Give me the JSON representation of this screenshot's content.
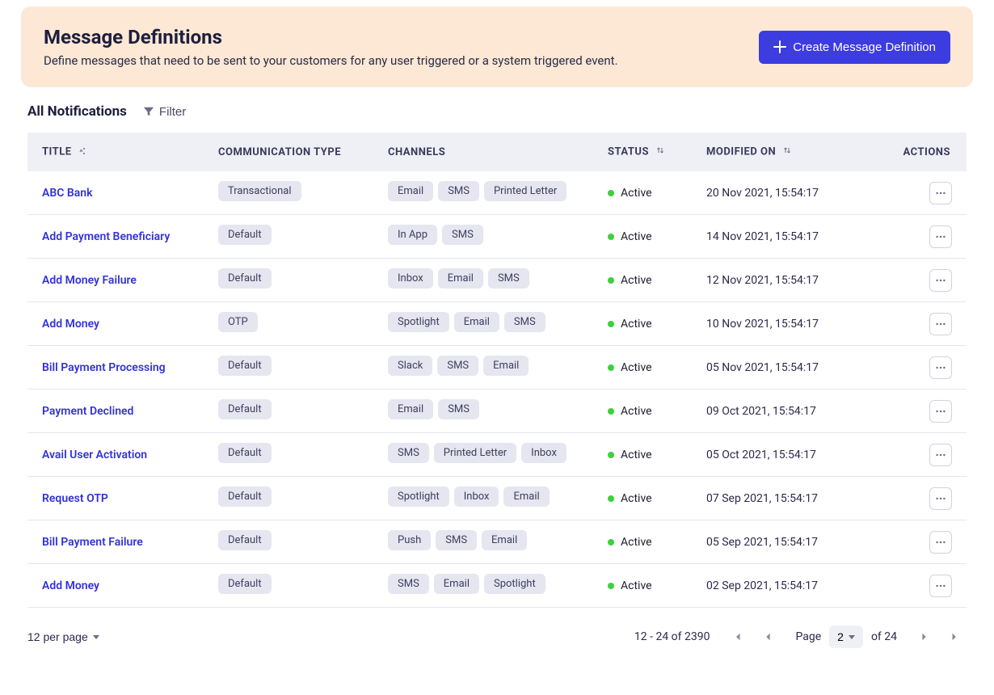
{
  "header": {
    "title": "Message Definitions",
    "subtitle": "Define messages that need to be sent to your customers for any user triggered or a system triggered event.",
    "create_label": "Create Message Definition"
  },
  "toolbar": {
    "title": "All Notifications",
    "filter_label": "Filter"
  },
  "columns": {
    "title": "TITLE",
    "comm_type": "COMMUNICATION TYPE",
    "channels": "CHANNELS",
    "status": "STATUS",
    "modified": "MODIFIED ON",
    "actions": "ACTIONS"
  },
  "rows": [
    {
      "title": "ABC Bank",
      "comm": "Transactional",
      "channels": [
        "Email",
        "SMS",
        "Printed Letter"
      ],
      "status": "Active",
      "modified": "20 Nov 2021, 15:54:17"
    },
    {
      "title": "Add Payment Beneficiary",
      "comm": "Default",
      "channels": [
        "In App",
        "SMS"
      ],
      "status": "Active",
      "modified": "14 Nov 2021, 15:54:17"
    },
    {
      "title": "Add Money Failure",
      "comm": "Default",
      "channels": [
        "Inbox",
        "Email",
        "SMS"
      ],
      "status": "Active",
      "modified": "12 Nov 2021, 15:54:17"
    },
    {
      "title": "Add Money",
      "comm": "OTP",
      "channels": [
        "Spotlight",
        "Email",
        "SMS"
      ],
      "status": "Active",
      "modified": "10 Nov 2021, 15:54:17"
    },
    {
      "title": "Bill Payment Processing",
      "comm": "Default",
      "channels": [
        "Slack",
        "SMS",
        "Email"
      ],
      "status": "Active",
      "modified": "05 Nov 2021, 15:54:17"
    },
    {
      "title": "Payment Declined",
      "comm": "Default",
      "channels": [
        "Email",
        "SMS"
      ],
      "status": "Active",
      "modified": "09 Oct 2021, 15:54:17"
    },
    {
      "title": "Avail User Activation",
      "comm": "Default",
      "channels": [
        "SMS",
        "Printed Letter",
        "Inbox"
      ],
      "status": "Active",
      "modified": "05 Oct 2021, 15:54:17"
    },
    {
      "title": "Request OTP",
      "comm": "Default",
      "channels": [
        "Spotlight",
        "Inbox",
        "Email"
      ],
      "status": "Active",
      "modified": "07 Sep 2021, 15:54:17"
    },
    {
      "title": "Bill Payment Failure",
      "comm": "Default",
      "channels": [
        "Push",
        "SMS",
        "Email"
      ],
      "status": "Active",
      "modified": "05 Sep 2021, 15:54:17"
    },
    {
      "title": "Add Money",
      "comm": "Default",
      "channels": [
        "SMS",
        "Email",
        "Spotlight"
      ],
      "status": "Active",
      "modified": "02 Sep 2021, 15:54:17"
    }
  ],
  "pagination": {
    "per_page_label": "12 per page",
    "range_label": "12 - 24 of 2390",
    "page_label": "Page",
    "current_page": "2",
    "total_pages_label": "of 24"
  }
}
